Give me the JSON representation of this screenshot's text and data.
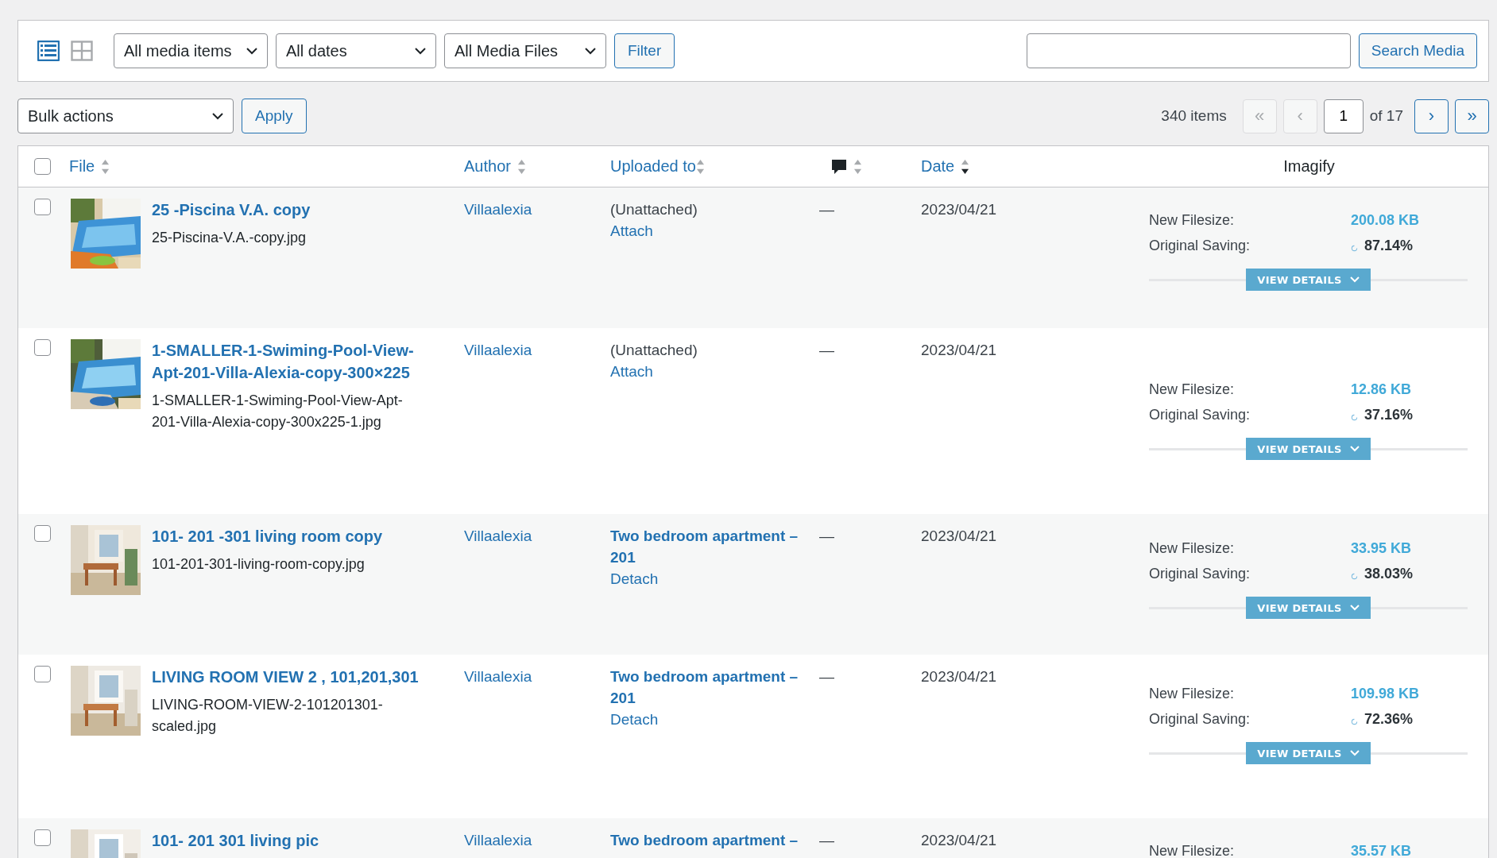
{
  "toolbar": {
    "view_modes": [
      {
        "kind": "list",
        "selected": true
      },
      {
        "kind": "grid",
        "selected": false
      }
    ],
    "filters": [
      {
        "value": "All media items"
      },
      {
        "value": "All dates"
      },
      {
        "value": "All Media Files"
      }
    ],
    "filter_button": "Filter",
    "search_button": "Search Media"
  },
  "bulk": {
    "select": "Bulk actions",
    "apply": "Apply"
  },
  "pagination": {
    "count": "340 items",
    "buttons": [
      {
        "label": "«",
        "disabled": true
      },
      {
        "label": "‹",
        "disabled": true
      }
    ],
    "page": "1",
    "of": "of 17",
    "next_buttons": [
      {
        "label": "›",
        "disabled": false
      },
      {
        "label": "»",
        "disabled": false
      }
    ]
  },
  "table": {
    "select_all": {
      "checked": false
    },
    "columns": [
      {
        "kind": "file",
        "label": "File",
        "sortable": true,
        "sorted": false
      },
      {
        "kind": "author",
        "label": "Author",
        "sortable": true,
        "sorted": false
      },
      {
        "kind": "uploaded",
        "label": "Uploaded to",
        "sortable": true,
        "sorted": false
      },
      {
        "kind": "comments",
        "sortable": true,
        "sorted": false
      },
      {
        "kind": "date",
        "label": "Date",
        "sortable": true,
        "sorted": true
      },
      {
        "kind": "imagify",
        "label": "Imagify",
        "sortable": false
      }
    ],
    "rows": [
      {
        "checked": false,
        "title": "25 -Piscina V.A. copy",
        "filename": "25-Piscina-V.A.-copy.jpg",
        "author": "Villaalexia",
        "uploaded": "(Unattached)",
        "uploaded_linked": false,
        "action": "Attach",
        "comments": "—",
        "date": "2023/04/21",
        "new_filesize_label": "New Filesize:",
        "new_filesize": "200.08 KB",
        "saving_label": "Original Saving:",
        "saving": "87.14%",
        "details": "VIEW DETAILS"
      },
      {
        "checked": false,
        "title": "1-SMALLER-1-Swiming-Pool-View-Apt-201-Villa-Alexia-copy-300×225",
        "filename": "1-SMALLER-1-Swiming-Pool-View-Apt-201-Villa-Alexia-copy-300x225-1.jpg",
        "author": "Villaalexia",
        "uploaded": "(Unattached)",
        "uploaded_linked": false,
        "action": "Attach",
        "comments": "—",
        "date": "2023/04/21",
        "new_filesize_label": "New Filesize:",
        "new_filesize": "12.86 KB",
        "saving_label": "Original Saving:",
        "saving": "37.16%",
        "details": "VIEW DETAILS"
      },
      {
        "checked": false,
        "title": "101- 201 -301 living room copy",
        "filename": "101-201-301-living-room-copy.jpg",
        "author": "Villaalexia",
        "uploaded": "Two bedroom apartment – 201",
        "uploaded_linked": true,
        "action": "Detach",
        "comments": "—",
        "date": "2023/04/21",
        "new_filesize_label": "New Filesize:",
        "new_filesize": "33.95 KB",
        "saving_label": "Original Saving:",
        "saving": "38.03%",
        "details": "VIEW DETAILS"
      },
      {
        "checked": false,
        "title": "LIVING ROOM VIEW 2 , 101,201,301",
        "filename": "LIVING-ROOM-VIEW-2-101201301-scaled.jpg",
        "author": "Villaalexia",
        "uploaded": "Two bedroom apartment – 201",
        "uploaded_linked": true,
        "action": "Detach",
        "comments": "—",
        "date": "2023/04/21",
        "new_filesize_label": "New Filesize:",
        "new_filesize": "109.98 KB",
        "saving_label": "Original Saving:",
        "saving": "72.36%",
        "details": "VIEW DETAILS"
      },
      {
        "checked": false,
        "title": "101- 201 301 living pic",
        "author": "Villaalexia",
        "uploaded": "Two bedroom apartment –",
        "uploaded_linked": true,
        "comments": "—",
        "date": "2023/04/21",
        "new_filesize_label": "New Filesize:",
        "new_filesize": "35.57 KB"
      }
    ]
  }
}
